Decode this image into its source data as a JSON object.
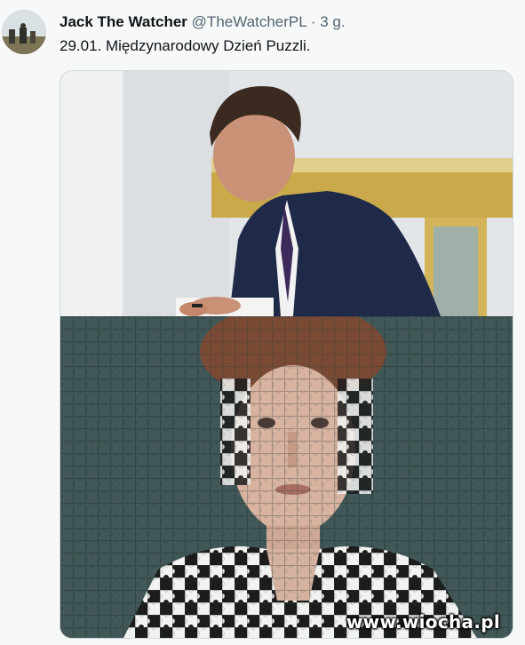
{
  "tweet": {
    "author_name": "Jack The Watcher",
    "handle": "@TheWatcherPL",
    "separator": "·",
    "time": "3 g.",
    "text": "29.01. Międzynarodowy Dzień Puzzli."
  },
  "media": {
    "top_photo": "man-signing-document",
    "bottom_photo": "jigsaw-puzzle-portrait",
    "watermark": "www.wiocha.pl"
  }
}
